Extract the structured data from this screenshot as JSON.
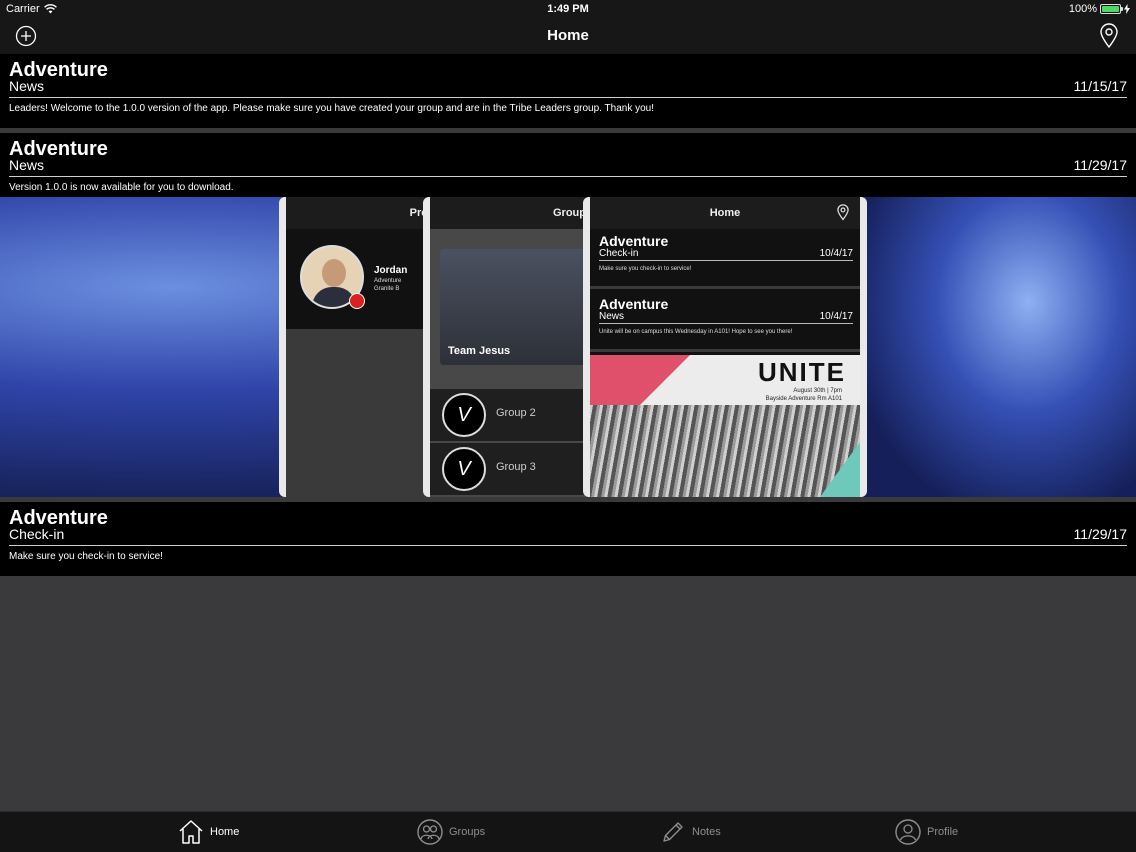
{
  "status_bar": {
    "carrier": "Carrier",
    "time": "1:49 PM",
    "battery": "100%",
    "battery_level": 1.0
  },
  "nav": {
    "title": "Home",
    "left_icon": "add-circle-icon",
    "right_icon": "location-pin-icon"
  },
  "feed": [
    {
      "brand": "Adventure",
      "category": "News",
      "date": "11/15/17",
      "message": "Leaders! Welcome to the 1.0.0 version of the app. Please make sure you have created your group and are in the Tribe Leaders group. Thank you!"
    },
    {
      "brand": "Adventure",
      "category": "News",
      "date": "11/29/17",
      "message": "Version 1.0.0 is now available for you to download.",
      "image": {
        "phone1": {
          "title": "Pro",
          "name": "Jordan",
          "sub1": "Adventure",
          "sub2": "Granite B"
        },
        "phone2": {
          "title": "Group",
          "team": "Team Jesus",
          "group2": "Group 2",
          "group3": "Group 3"
        },
        "phone3": {
          "title": "Home",
          "item1": {
            "brand": "Adventure",
            "category": "Check-in",
            "date": "10/4/17",
            "text": "Make sure you check-in to service!"
          },
          "item2": {
            "brand": "Adventure",
            "category": "News",
            "date": "10/4/17",
            "text": "Unite will be on campus this Wednesday in A101! Hope to see you there!"
          },
          "poster_word": "UNITE",
          "poster_line1": "August 30th | 7pm",
          "poster_line2": "Bayside Adventure Rm A101"
        }
      }
    },
    {
      "brand": "Adventure",
      "category": "Check-in",
      "date": "11/29/17",
      "message": "Make sure you check-in to service!"
    }
  ],
  "tabs": [
    {
      "label": "Home",
      "icon": "home-icon",
      "active": true
    },
    {
      "label": "Groups",
      "icon": "groups-icon",
      "active": false
    },
    {
      "label": "Notes",
      "icon": "pencil-icon",
      "active": false
    },
    {
      "label": "Profile",
      "icon": "profile-icon",
      "active": false
    }
  ],
  "colors": {
    "background": "#3a393b",
    "bar": "#171717",
    "card": "#000000",
    "battery": "#4cd964"
  }
}
